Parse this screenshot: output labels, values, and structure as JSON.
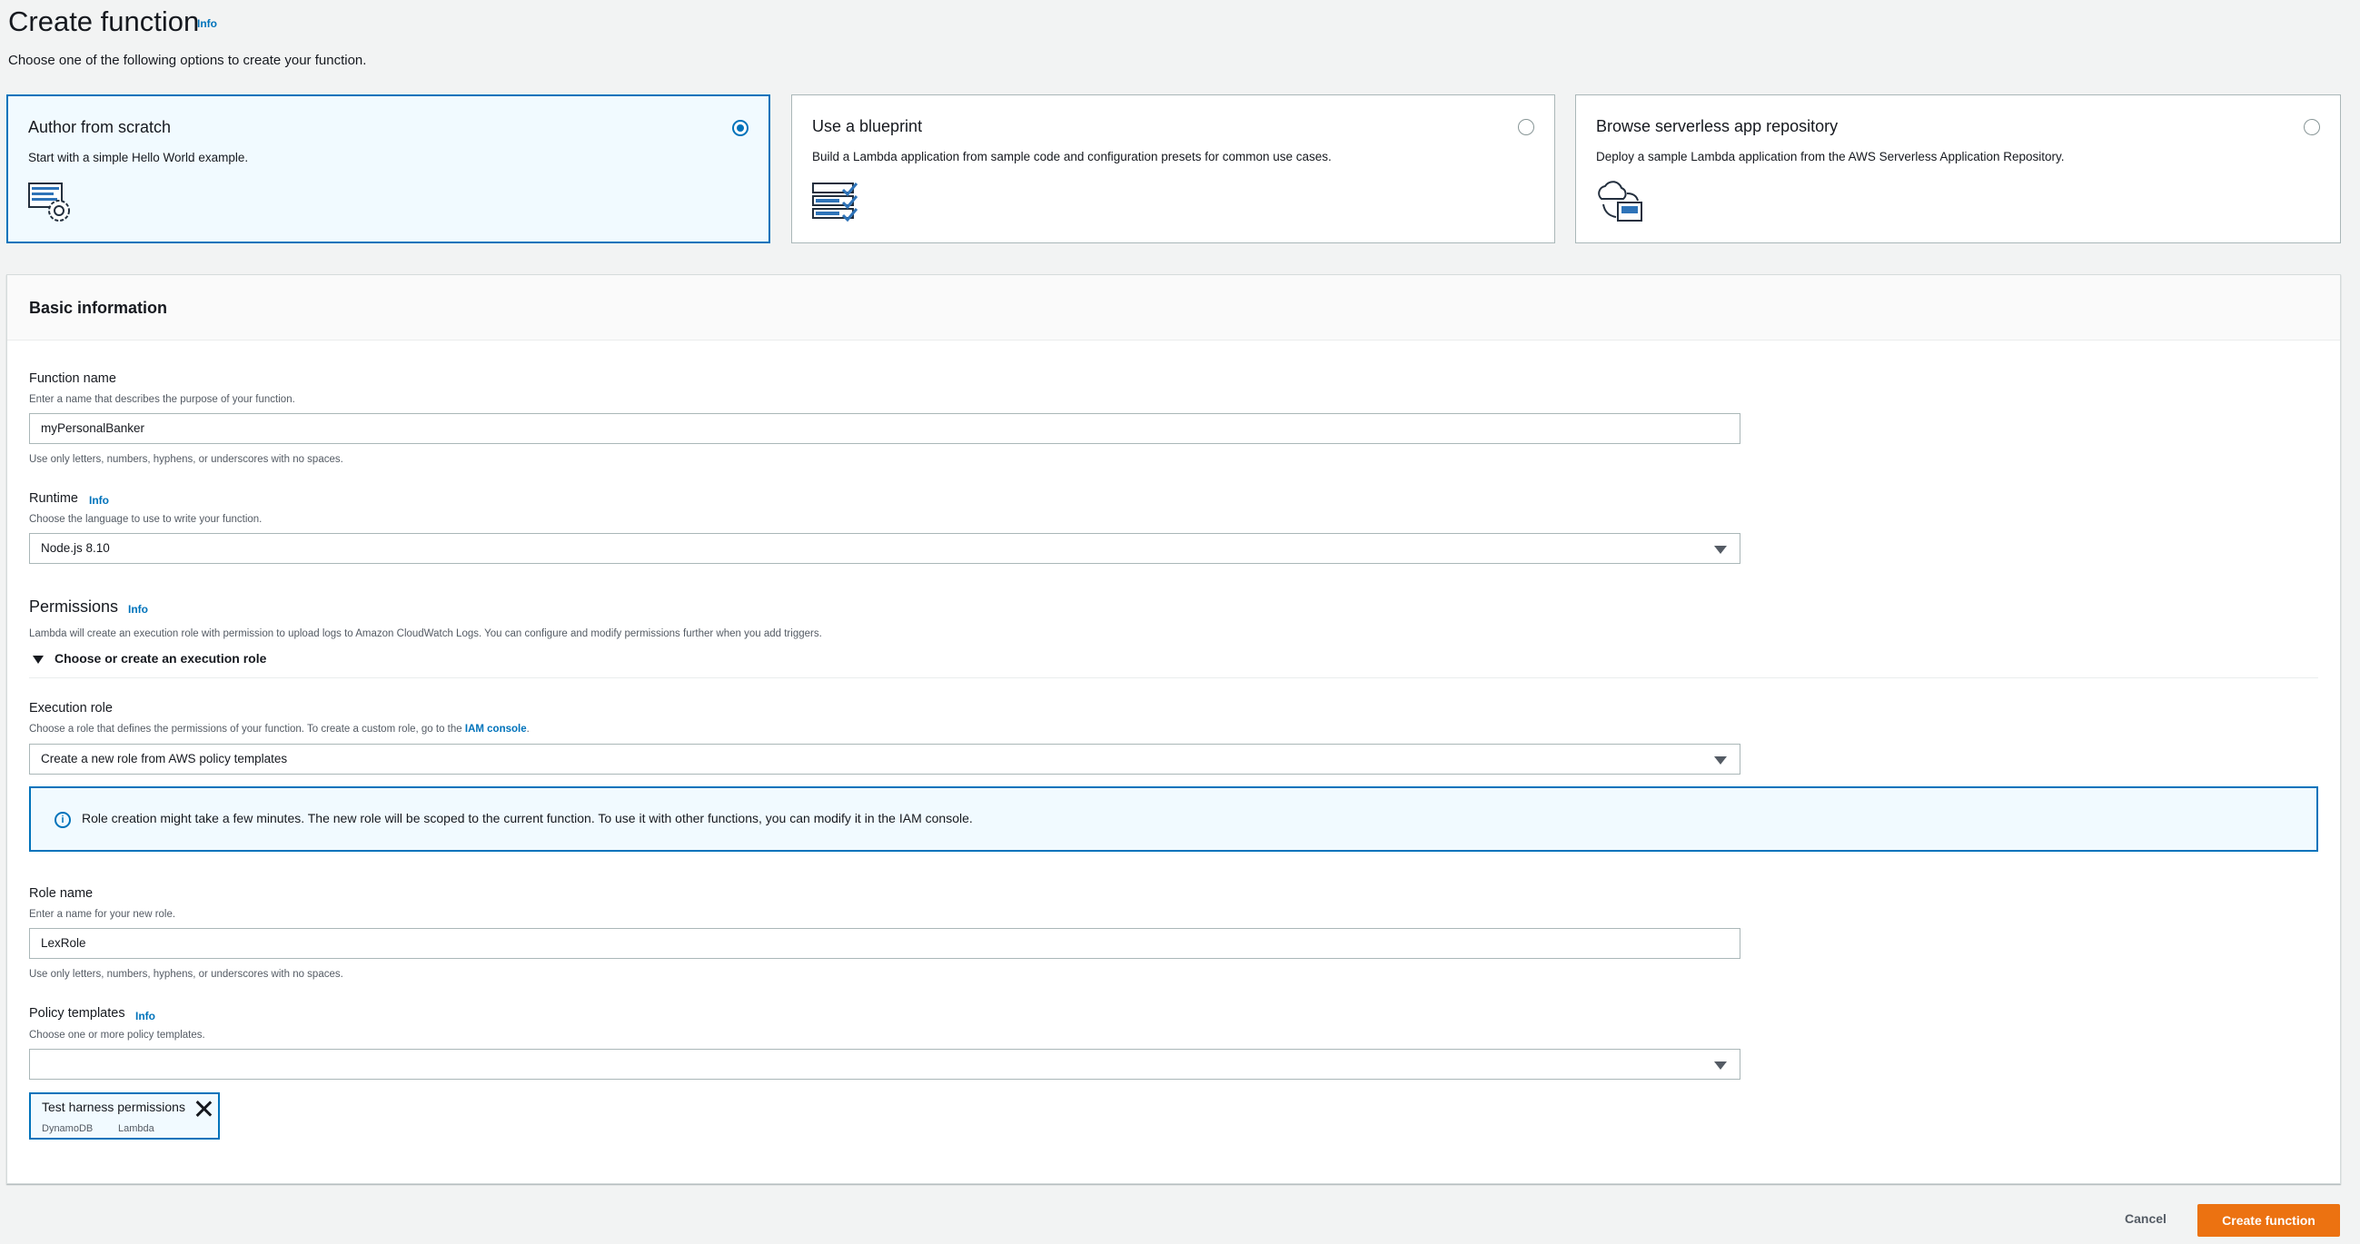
{
  "header": {
    "title": "Create function",
    "info_label": "Info",
    "subtitle": "Choose one of the following options to create your function."
  },
  "options": [
    {
      "title": "Author from scratch",
      "description": "Start with a simple Hello World example.",
      "selected": true,
      "icon": "author-code-gear-icon"
    },
    {
      "title": "Use a blueprint",
      "description": "Build a Lambda application from sample code and configuration presets for common use cases.",
      "selected": false,
      "icon": "blueprint-checklist-icon"
    },
    {
      "title": "Browse serverless app repository",
      "description": "Deploy a sample Lambda application from the AWS Serverless Application Repository.",
      "selected": false,
      "icon": "cloud-repository-icon"
    }
  ],
  "basic_info": {
    "heading": "Basic information",
    "function_name": {
      "label": "Function name",
      "description": "Enter a name that describes the purpose of your function.",
      "value": "myPersonalBanker",
      "constraint": "Use only letters, numbers, hyphens, or underscores with no spaces."
    },
    "runtime": {
      "label": "Runtime",
      "info_label": "Info",
      "description": "Choose the language to use to write your function.",
      "value": "Node.js 8.10"
    },
    "permissions": {
      "heading": "Permissions",
      "info_label": "Info",
      "description": "Lambda will create an execution role with permission to upload logs to Amazon CloudWatch Logs. You can configure and modify permissions further when you add triggers.",
      "expander_label": "Choose or create an execution role"
    },
    "execution_role": {
      "label": "Execution role",
      "description_prefix": "Choose a role that defines the permissions of your function. To create a custom role, go to the",
      "description_link": "IAM console",
      "description_suffix": ".",
      "value": "Create a new role from AWS policy templates"
    },
    "alert": {
      "text": "Role creation might take a few minutes. The new role will be scoped to the current function. To use it with other functions, you can modify it in the IAM console.",
      "icon_glyph": "i"
    },
    "role_name": {
      "label": "Role name",
      "description": "Enter a name for your new role.",
      "value": "LexRole",
      "constraint": "Use only letters, numbers, hyphens, or underscores with no spaces."
    },
    "policy_templates": {
      "label": "Policy templates",
      "info_label": "Info",
      "description": "Choose one or more policy templates.",
      "value": "",
      "token": {
        "name": "Test harness permissions",
        "tags": [
          "DynamoDB",
          "Lambda"
        ]
      }
    }
  },
  "footer": {
    "cancel_label": "Cancel",
    "create_label": "Create function"
  },
  "colors": {
    "accent": "#0073bb",
    "primary_button": "#ec7211",
    "background": "#f2f3f3"
  }
}
